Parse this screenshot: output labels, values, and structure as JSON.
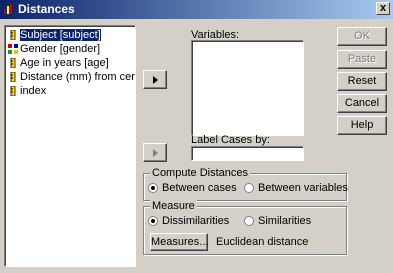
{
  "window": {
    "title": "Distances",
    "close_glyph": "x"
  },
  "variables": [
    {
      "label": "Subject [subject]",
      "icon": "ruler-icon",
      "selected": true
    },
    {
      "label": "Gender [gender]",
      "icon": "nominal-icon",
      "selected": false
    },
    {
      "label": "Age in years [age]",
      "icon": "ruler-icon",
      "selected": false
    },
    {
      "label": "Distance (mm) from cer",
      "icon": "ruler-icon",
      "selected": false
    },
    {
      "label": "index",
      "icon": "ruler-icon",
      "selected": false
    }
  ],
  "labels": {
    "variables": "Variables:",
    "label_cases_by": "Label Cases by:"
  },
  "buttons": {
    "ok": "OK",
    "paste": "Paste",
    "reset": "Reset",
    "cancel": "Cancel",
    "help": "Help",
    "measures": "Measures..."
  },
  "compute_distances": {
    "legend": "Compute Distances",
    "between_cases": "Between cases",
    "between_variables": "Between variables",
    "selected": "between_cases"
  },
  "measure": {
    "legend": "Measure",
    "dissimilarities": "Dissimilarities",
    "similarities": "Similarities",
    "selected": "dissimilarities",
    "current": "Euclidean distance"
  }
}
